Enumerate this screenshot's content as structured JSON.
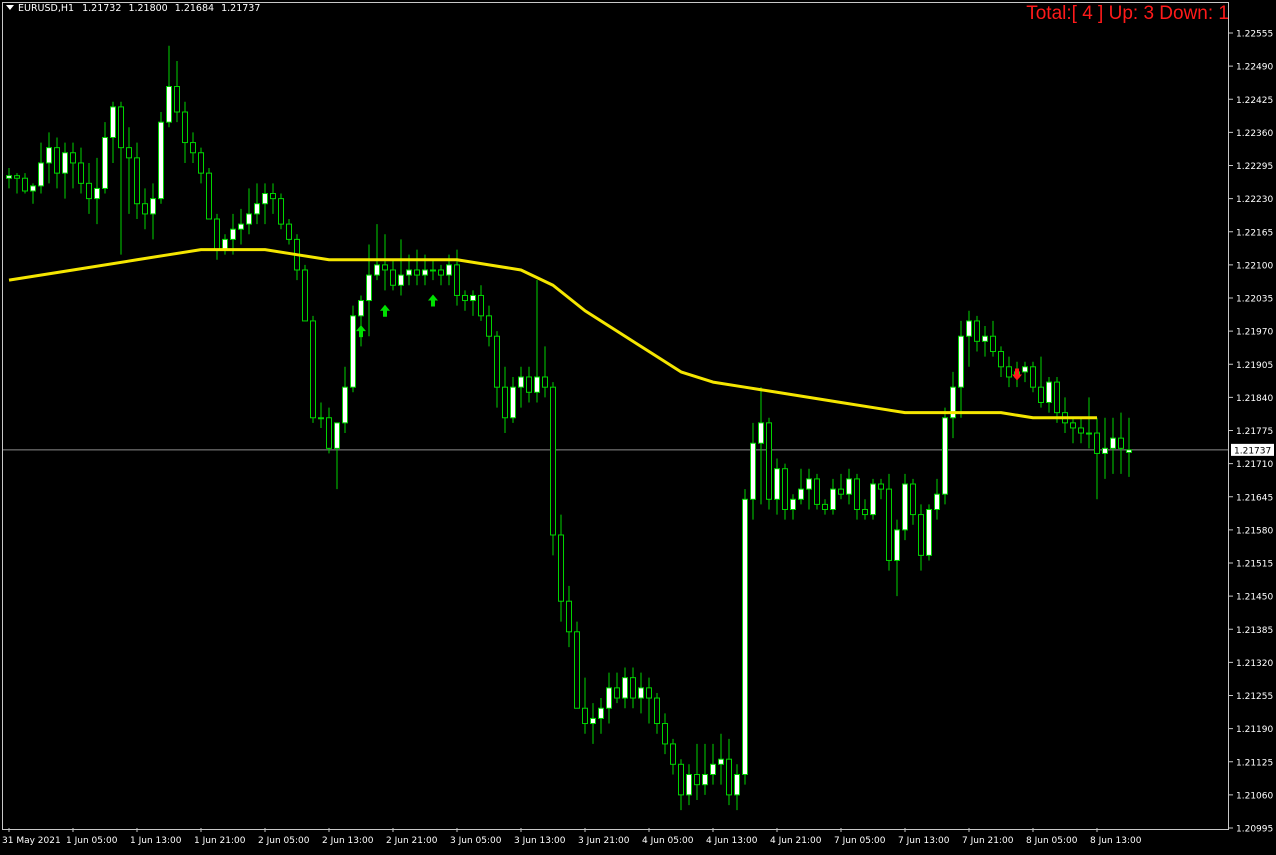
{
  "header": {
    "symbol": "EURUSD,H1",
    "open": "1.21732",
    "high": "1.21800",
    "low": "1.21684",
    "close": "1.21737"
  },
  "stats_label": "Total:[ 4 ] Up: 3 Down: 1",
  "colors": {
    "background": "#000000",
    "candle": "#00d400",
    "candle_bull_body": "#ffffff",
    "moving_average": "#f5e600",
    "arrow_up": "#00e000",
    "arrow_down": "#ff1a1a",
    "price_line": "#8c8c8c",
    "axis_text": "#ffffff"
  },
  "chart_data": {
    "type": "candlestick",
    "symbol": "EURUSD",
    "timeframe": "H1",
    "ylim": [
      1.20995,
      1.22555
    ],
    "y_ticks": [
      "1.22555",
      "1.22490",
      "1.22425",
      "1.22360",
      "1.22295",
      "1.22230",
      "1.22165",
      "1.22100",
      "1.22035",
      "1.21970",
      "1.21905",
      "1.21840",
      "1.21775",
      "1.21710",
      "1.21645",
      "1.21580",
      "1.21515",
      "1.21450",
      "1.21385",
      "1.21320",
      "1.21255",
      "1.21190",
      "1.21125",
      "1.21060",
      "1.20995"
    ],
    "x_ticks": [
      {
        "label": "31 May 2021",
        "bar": 0
      },
      {
        "label": "1 Jun 05:00",
        "bar": 8
      },
      {
        "label": "1 Jun 13:00",
        "bar": 16
      },
      {
        "label": "1 Jun 21:00",
        "bar": 24
      },
      {
        "label": "2 Jun 05:00",
        "bar": 32
      },
      {
        "label": "2 Jun 13:00",
        "bar": 40
      },
      {
        "label": "2 Jun 21:00",
        "bar": 48
      },
      {
        "label": "3 Jun 05:00",
        "bar": 56
      },
      {
        "label": "3 Jun 13:00",
        "bar": 64
      },
      {
        "label": "3 Jun 21:00",
        "bar": 72
      },
      {
        "label": "4 Jun 05:00",
        "bar": 80
      },
      {
        "label": "4 Jun 13:00",
        "bar": 88
      },
      {
        "label": "4 Jun 21:00",
        "bar": 96
      },
      {
        "label": "7 Jun 05:00",
        "bar": 104
      },
      {
        "label": "7 Jun 13:00",
        "bar": 112
      },
      {
        "label": "7 Jun 21:00",
        "bar": 120
      },
      {
        "label": "8 Jun 05:00",
        "bar": 128
      },
      {
        "label": "8 Jun 13:00",
        "bar": 136
      }
    ],
    "current_price": "1.21737",
    "candles": [
      [
        1.2227,
        1.2229,
        1.2225,
        1.22275
      ],
      [
        1.22275,
        1.2228,
        1.2224,
        1.2227
      ],
      [
        1.2227,
        1.2228,
        1.2224,
        1.22245
      ],
      [
        1.22245,
        1.2226,
        1.2222,
        1.22255
      ],
      [
        1.22255,
        1.2234,
        1.2224,
        1.223
      ],
      [
        1.223,
        1.2236,
        1.2226,
        1.2233
      ],
      [
        1.2233,
        1.2235,
        1.2225,
        1.2228
      ],
      [
        1.2228,
        1.2234,
        1.2223,
        1.2232
      ],
      [
        1.2232,
        1.2234,
        1.2225,
        1.223
      ],
      [
        1.223,
        1.2233,
        1.2224,
        1.2226
      ],
      [
        1.2226,
        1.223,
        1.222,
        1.2223
      ],
      [
        1.2223,
        1.2231,
        1.2218,
        1.2225
      ],
      [
        1.2225,
        1.2238,
        1.2224,
        1.2235
      ],
      [
        1.2235,
        1.2242,
        1.223,
        1.2241
      ],
      [
        1.2241,
        1.2242,
        1.2212,
        1.2233
      ],
      [
        1.2233,
        1.2237,
        1.222,
        1.2231
      ],
      [
        1.2231,
        1.2234,
        1.2219,
        1.2222
      ],
      [
        1.2222,
        1.2225,
        1.2217,
        1.222
      ],
      [
        1.222,
        1.2226,
        1.2215,
        1.2223
      ],
      [
        1.2223,
        1.224,
        1.2222,
        1.2238
      ],
      [
        1.2238,
        1.2253,
        1.2237,
        1.2245
      ],
      [
        1.2245,
        1.225,
        1.2238,
        1.224
      ],
      [
        1.224,
        1.2242,
        1.223,
        1.2234
      ],
      [
        1.2234,
        1.2236,
        1.223,
        1.2232
      ],
      [
        1.2232,
        1.2233,
        1.2226,
        1.2228
      ],
      [
        1.2228,
        1.2229,
        1.2219,
        1.2219
      ],
      [
        1.2219,
        1.222,
        1.2211,
        1.2213
      ],
      [
        1.2213,
        1.2216,
        1.2212,
        1.2215
      ],
      [
        1.2215,
        1.222,
        1.2212,
        1.2217
      ],
      [
        1.2217,
        1.2221,
        1.2214,
        1.2218
      ],
      [
        1.2218,
        1.2225,
        1.2216,
        1.222
      ],
      [
        1.222,
        1.2226,
        1.2218,
        1.2222
      ],
      [
        1.2222,
        1.2226,
        1.2218,
        1.2224
      ],
      [
        1.2224,
        1.2226,
        1.222,
        1.2223
      ],
      [
        1.2223,
        1.2224,
        1.2217,
        1.2218
      ],
      [
        1.2218,
        1.2219,
        1.2214,
        1.2215
      ],
      [
        1.2215,
        1.2216,
        1.2207,
        1.2209
      ],
      [
        1.2209,
        1.221,
        1.2199,
        1.2199
      ],
      [
        1.2199,
        1.22,
        1.2179,
        1.218
      ],
      [
        1.218,
        1.2183,
        1.2178,
        1.218
      ],
      [
        1.218,
        1.2182,
        1.2173,
        1.2174
      ],
      [
        1.2174,
        1.2179,
        1.2166,
        1.2179
      ],
      [
        1.2179,
        1.219,
        1.2177,
        1.2186
      ],
      [
        1.2186,
        1.2202,
        1.2185,
        1.22
      ],
      [
        1.22,
        1.2204,
        1.2194,
        1.2203
      ],
      [
        1.2203,
        1.2214,
        1.2196,
        1.2208
      ],
      [
        1.2208,
        1.2218,
        1.2207,
        1.221
      ],
      [
        1.221,
        1.2216,
        1.2205,
        1.2209
      ],
      [
        1.2209,
        1.2211,
        1.2205,
        1.2206
      ],
      [
        1.2206,
        1.2215,
        1.2204,
        1.2208
      ],
      [
        1.2208,
        1.2212,
        1.2206,
        1.2209
      ],
      [
        1.2209,
        1.2213,
        1.2206,
        1.2208
      ],
      [
        1.2208,
        1.2212,
        1.2206,
        1.2209
      ],
      [
        1.2209,
        1.2211,
        1.2207,
        1.2209
      ],
      [
        1.2209,
        1.221,
        1.2206,
        1.2208
      ],
      [
        1.2208,
        1.2212,
        1.2206,
        1.221
      ],
      [
        1.221,
        1.2213,
        1.2202,
        1.2204
      ],
      [
        1.2204,
        1.2205,
        1.2201,
        1.2203
      ],
      [
        1.2203,
        1.2205,
        1.22,
        1.2204
      ],
      [
        1.2204,
        1.2206,
        1.2199,
        1.22
      ],
      [
        1.22,
        1.2202,
        1.2194,
        1.2196
      ],
      [
        1.2196,
        1.2197,
        1.2182,
        1.2186
      ],
      [
        1.2186,
        1.219,
        1.2177,
        1.218
      ],
      [
        1.218,
        1.2188,
        1.2179,
        1.2186
      ],
      [
        1.2186,
        1.219,
        1.2182,
        1.2188
      ],
      [
        1.2188,
        1.219,
        1.2183,
        1.2185
      ],
      [
        1.2185,
        1.2207,
        1.2183,
        1.2188
      ],
      [
        1.2188,
        1.2194,
        1.2184,
        1.2186
      ],
      [
        1.2186,
        1.2187,
        1.2153,
        1.2157
      ],
      [
        1.2157,
        1.2161,
        1.214,
        1.2144
      ],
      [
        1.2144,
        1.2147,
        1.2135,
        1.2138
      ],
      [
        1.2138,
        1.214,
        1.2123,
        1.2123
      ],
      [
        1.2123,
        1.2129,
        1.2118,
        1.212
      ],
      [
        1.212,
        1.2124,
        1.2116,
        1.2121
      ],
      [
        1.2121,
        1.2125,
        1.2118,
        1.2123
      ],
      [
        1.2123,
        1.213,
        1.212,
        1.2127
      ],
      [
        1.2127,
        1.213,
        1.2124,
        1.2125
      ],
      [
        1.2125,
        1.2131,
        1.2123,
        1.2129
      ],
      [
        1.2129,
        1.2131,
        1.2123,
        1.2125
      ],
      [
        1.2125,
        1.213,
        1.2122,
        1.2127
      ],
      [
        1.2127,
        1.2129,
        1.212,
        1.2125
      ],
      [
        1.2125,
        1.2126,
        1.2118,
        1.212
      ],
      [
        1.212,
        1.2122,
        1.2114,
        1.2116
      ],
      [
        1.2116,
        1.2117,
        1.211,
        1.2112
      ],
      [
        1.2112,
        1.2113,
        1.2103,
        1.2106
      ],
      [
        1.2106,
        1.2112,
        1.2104,
        1.211
      ],
      [
        1.211,
        1.2116,
        1.2105,
        1.2108
      ],
      [
        1.2108,
        1.2116,
        1.2106,
        1.211
      ],
      [
        1.211,
        1.2116,
        1.2108,
        1.2112
      ],
      [
        1.2112,
        1.2118,
        1.2108,
        1.2113
      ],
      [
        1.2113,
        1.2117,
        1.2104,
        1.2106
      ],
      [
        1.2106,
        1.2112,
        1.2103,
        1.211
      ],
      [
        1.211,
        1.2166,
        1.2108,
        1.2164
      ],
      [
        1.2164,
        1.2179,
        1.216,
        1.2175
      ],
      [
        1.2175,
        1.2186,
        1.2163,
        1.2179
      ],
      [
        1.2179,
        1.218,
        1.2162,
        1.2164
      ],
      [
        1.2164,
        1.2172,
        1.2161,
        1.217
      ],
      [
        1.217,
        1.2171,
        1.216,
        1.2162
      ],
      [
        1.2162,
        1.2165,
        1.216,
        1.2164
      ],
      [
        1.2164,
        1.217,
        1.2163,
        1.2166
      ],
      [
        1.2166,
        1.217,
        1.2162,
        1.2168
      ],
      [
        1.2168,
        1.2169,
        1.2162,
        1.2163
      ],
      [
        1.2163,
        1.2164,
        1.2161,
        1.2162
      ],
      [
        1.2162,
        1.2168,
        1.2161,
        1.2166
      ],
      [
        1.2166,
        1.2169,
        1.2164,
        1.2165
      ],
      [
        1.2165,
        1.217,
        1.2163,
        1.2168
      ],
      [
        1.2168,
        1.2169,
        1.216,
        1.2162
      ],
      [
        1.2162,
        1.2164,
        1.216,
        1.2161
      ],
      [
        1.2161,
        1.2168,
        1.216,
        1.2167
      ],
      [
        1.2167,
        1.2168,
        1.2164,
        1.2166
      ],
      [
        1.2166,
        1.2169,
        1.215,
        1.2152
      ],
      [
        1.2152,
        1.216,
        1.2145,
        1.2158
      ],
      [
        1.2158,
        1.2169,
        1.2156,
        1.2167
      ],
      [
        1.2167,
        1.2168,
        1.2159,
        1.2161
      ],
      [
        1.2161,
        1.2163,
        1.215,
        1.2153
      ],
      [
        1.2153,
        1.2163,
        1.2152,
        1.2162
      ],
      [
        1.2162,
        1.2168,
        1.216,
        1.2165
      ],
      [
        1.2165,
        1.2182,
        1.2163,
        1.218
      ],
      [
        1.218,
        1.2189,
        1.2176,
        1.2186
      ],
      [
        1.2186,
        1.2199,
        1.218,
        1.2196
      ],
      [
        1.2196,
        1.2201,
        1.219,
        1.2199
      ],
      [
        1.2199,
        1.22,
        1.2193,
        1.2195
      ],
      [
        1.2195,
        1.2198,
        1.2192,
        1.2196
      ],
      [
        1.2196,
        1.2199,
        1.2192,
        1.2193
      ],
      [
        1.2193,
        1.2194,
        1.2188,
        1.219
      ],
      [
        1.219,
        1.2192,
        1.2186,
        1.2188
      ],
      [
        1.2188,
        1.2191,
        1.2186,
        1.2189
      ],
      [
        1.2189,
        1.2191,
        1.2187,
        1.219
      ],
      [
        1.219,
        1.2191,
        1.2185,
        1.2186
      ],
      [
        1.2186,
        1.2192,
        1.2182,
        1.2183
      ],
      [
        1.2183,
        1.2188,
        1.2181,
        1.2187
      ],
      [
        1.2187,
        1.2188,
        1.2179,
        1.2181
      ],
      [
        1.2181,
        1.2184,
        1.2177,
        1.2179
      ],
      [
        1.2179,
        1.218,
        1.2175,
        1.2178
      ],
      [
        1.2178,
        1.218,
        1.2175,
        1.2177
      ],
      [
        1.2177,
        1.2184,
        1.2174,
        1.2177
      ],
      [
        1.2177,
        1.218,
        1.2164,
        1.2173
      ],
      [
        1.2173,
        1.218,
        1.2168,
        1.2174
      ],
      [
        1.2174,
        1.218,
        1.2169,
        1.2176
      ],
      [
        1.2176,
        1.2181,
        1.2169,
        1.2174
      ],
      [
        1.21732,
        1.218,
        1.21684,
        1.21737
      ]
    ],
    "moving_average": [
      [
        0,
        1.2207
      ],
      [
        8,
        1.2209
      ],
      [
        16,
        1.2211
      ],
      [
        20,
        1.2212
      ],
      [
        24,
        1.2213
      ],
      [
        28,
        1.2213
      ],
      [
        32,
        1.2213
      ],
      [
        36,
        1.2212
      ],
      [
        40,
        1.2211
      ],
      [
        44,
        1.2211
      ],
      [
        48,
        1.2211
      ],
      [
        52,
        1.2211
      ],
      [
        56,
        1.2211
      ],
      [
        60,
        1.221
      ],
      [
        64,
        1.2209
      ],
      [
        68,
        1.2206
      ],
      [
        72,
        1.2201
      ],
      [
        76,
        1.2197
      ],
      [
        80,
        1.2193
      ],
      [
        84,
        1.2189
      ],
      [
        88,
        1.2187
      ],
      [
        92,
        1.2186
      ],
      [
        96,
        1.2185
      ],
      [
        100,
        1.2184
      ],
      [
        104,
        1.2183
      ],
      [
        108,
        1.2182
      ],
      [
        112,
        1.2181
      ],
      [
        116,
        1.2181
      ],
      [
        120,
        1.2181
      ],
      [
        124,
        1.2181
      ],
      [
        128,
        1.218
      ],
      [
        132,
        1.218
      ],
      [
        136,
        1.218
      ]
    ],
    "signals": [
      {
        "bar": 44,
        "direction": "up",
        "price": 1.2197
      },
      {
        "bar": 47,
        "direction": "up",
        "price": 1.2201
      },
      {
        "bar": 53,
        "direction": "up",
        "price": 1.2203
      },
      {
        "bar": 126,
        "direction": "down",
        "price": 1.21885
      }
    ]
  }
}
